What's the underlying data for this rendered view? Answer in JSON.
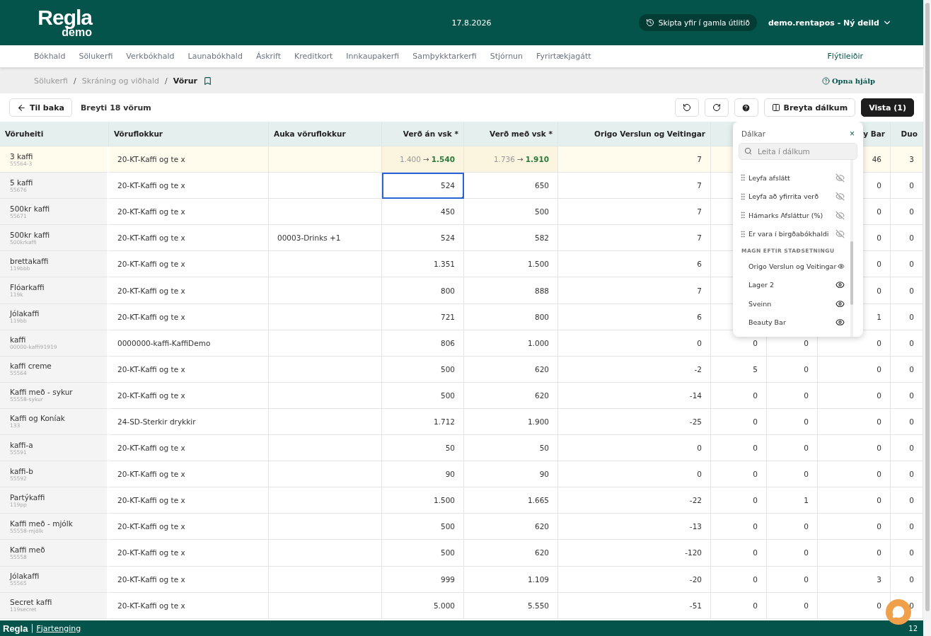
{
  "header": {
    "logo": "Regla",
    "logo_sub": "demo",
    "date": "17.8.2026",
    "switch_button": "Skipta yfir í gamla útlitið",
    "account": "demo.rentapos - Ný deild"
  },
  "nav": {
    "items": [
      {
        "label": "Bókhald"
      },
      {
        "label": "Sölukerfi"
      },
      {
        "label": "Verkbókhald"
      },
      {
        "label": "Launabókhald"
      },
      {
        "label": "Áskrift"
      },
      {
        "label": "Kreditkort"
      },
      {
        "label": "Innkaupakerfi"
      },
      {
        "label": "Samþykktarkerfi"
      },
      {
        "label": "Stjórnun"
      },
      {
        "label": "Fyrirtækjagátt"
      }
    ],
    "shortcuts": "Flýtileiðir"
  },
  "breadcrumbs": {
    "items": [
      "Sölukerfi",
      "Skráning og viðhald",
      "Vörur"
    ],
    "separators": [
      "/",
      "/"
    ],
    "help": "Opna hjálp"
  },
  "toolbar": {
    "back": "Til baka",
    "title": "Breyti 18 vörum",
    "columns_button": "Breyta dálkum",
    "save_button": "Vista (1)"
  },
  "table": {
    "columns": {
      "name": "Vöruheiti",
      "category": "Vöruflokkur",
      "extra": "Auka vöruflokkur",
      "price_ex": "Verð án vsk *",
      "price_inc": "Verð með vsk *",
      "origo": "Origo Verslun og Veitingar",
      "column_9": "y Bar",
      "duo": "Duo"
    },
    "rows": [
      {
        "name": "3 kaffi",
        "sku": "55564-3",
        "category": "20-KT-Kaffi og te x",
        "changed": true,
        "price_ex": {
          "old": "1.400",
          "arrow": "→",
          "value": "1.540",
          "selected": false
        },
        "price_inc": {
          "old": "1.736",
          "arrow": "→",
          "value": "1.910",
          "selected": false
        },
        "qty": {
          "origo": "7",
          "column_9": "46",
          "duo": "3"
        }
      },
      {
        "name": "5 kaffi",
        "sku": "55676",
        "category": "20-KT-Kaffi og te x",
        "changed": false,
        "price_ex": {
          "value": "524",
          "selected": true
        },
        "price_inc": {
          "value": "650",
          "selected": false
        },
        "qty": {
          "origo": "7",
          "column_9": "0",
          "duo": "0"
        }
      },
      {
        "name": "500kr kaffi",
        "sku": "55671",
        "category": "20-KT-Kaffi og te x",
        "changed": false,
        "price_ex": {
          "value": "450",
          "selected": false
        },
        "price_inc": {
          "value": "500",
          "selected": false
        },
        "qty": {
          "origo": "7",
          "column_9": "0",
          "duo": "0"
        }
      },
      {
        "name": "500kr kaffi",
        "sku": "500krkaffi",
        "category": "20-KT-Kaffi og te x",
        "extra": "00003-Drinks +1",
        "changed": false,
        "price_ex": {
          "value": "524",
          "selected": false
        },
        "price_inc": {
          "value": "582",
          "selected": false
        },
        "qty": {
          "origo": "7",
          "column_9": "0",
          "duo": "0"
        }
      },
      {
        "name": "brettakaffi",
        "sku": "119bbb",
        "category": "20-KT-Kaffi og te x",
        "changed": false,
        "price_ex": {
          "value": "1.351",
          "selected": false
        },
        "price_inc": {
          "value": "1.500",
          "selected": false
        },
        "qty": {
          "origo": "6",
          "column_9": "0",
          "duo": "0"
        }
      },
      {
        "name": "Flóarkaffi",
        "sku": "119k",
        "category": "20-KT-Kaffi og te x",
        "changed": false,
        "price_ex": {
          "value": "800",
          "selected": false
        },
        "price_inc": {
          "value": "888",
          "selected": false
        },
        "qty": {
          "origo": "7",
          "column_9": "0",
          "duo": "0"
        }
      },
      {
        "name": "Jólakaffi",
        "sku": "119bb",
        "category": "20-KT-Kaffi og te x",
        "changed": false,
        "price_ex": {
          "value": "721",
          "selected": false
        },
        "price_inc": {
          "value": "800",
          "selected": false
        },
        "qty": {
          "origo": "6",
          "column_9": "1",
          "duo": "0"
        }
      },
      {
        "name": "kaffi",
        "sku": "00000-kaffi91919",
        "category": "0000000-kaffi-KaffiDemo",
        "changed": false,
        "price_ex": {
          "value": "806",
          "selected": false
        },
        "price_inc": {
          "value": "1.000",
          "selected": false
        },
        "qty": {
          "origo": "0",
          "column_7": "0",
          "column_8": "0",
          "column_9": "0",
          "duo": "0"
        }
      },
      {
        "name": "kaffi creme",
        "sku": "55564",
        "category": "20-KT-Kaffi og te x",
        "changed": false,
        "price_ex": {
          "value": "500",
          "selected": false
        },
        "price_inc": {
          "value": "620",
          "selected": false
        },
        "qty": {
          "origo": "-2",
          "column_7": "5",
          "column_8": "0",
          "column_9": "0",
          "duo": "0"
        }
      },
      {
        "name": "Kaffi með - sykur",
        "sku": "55558-sykur",
        "category": "20-KT-Kaffi og te x",
        "changed": false,
        "price_ex": {
          "value": "500",
          "selected": false
        },
        "price_inc": {
          "value": "620",
          "selected": false
        },
        "qty": {
          "origo": "-14",
          "column_7": "0",
          "column_8": "0",
          "column_9": "0",
          "duo": "0"
        }
      },
      {
        "name": "Kaffi og Koníak",
        "sku": "133",
        "category": "24-SD-Sterkir drykkir",
        "changed": false,
        "price_ex": {
          "value": "1.712",
          "selected": false
        },
        "price_inc": {
          "value": "1.900",
          "selected": false
        },
        "qty": {
          "origo": "-25",
          "column_7": "0",
          "column_8": "0",
          "column_9": "0",
          "duo": "0"
        }
      },
      {
        "name": "kaffi-a",
        "sku": "55591",
        "category": "20-KT-Kaffi og te x",
        "changed": false,
        "price_ex": {
          "value": "50",
          "selected": false
        },
        "price_inc": {
          "value": "50",
          "selected": false
        },
        "qty": {
          "origo": "0",
          "column_7": "0",
          "column_8": "0",
          "column_9": "0",
          "duo": "0"
        }
      },
      {
        "name": "kaffi-b",
        "sku": "55592",
        "category": "20-KT-Kaffi og te x",
        "changed": false,
        "price_ex": {
          "value": "90",
          "selected": false
        },
        "price_inc": {
          "value": "90",
          "selected": false
        },
        "qty": {
          "origo": "0",
          "column_7": "0",
          "column_8": "0",
          "column_9": "0",
          "duo": "0"
        }
      },
      {
        "name": "Partýkaffi",
        "sku": "119pp",
        "category": "20-KT-Kaffi og te x",
        "changed": false,
        "price_ex": {
          "value": "1.500",
          "selected": false
        },
        "price_inc": {
          "value": "1.665",
          "selected": false
        },
        "qty": {
          "origo": "-22",
          "column_7": "0",
          "column_8": "1",
          "column_9": "0",
          "duo": "0"
        }
      },
      {
        "name": "Kaffi með - mjólk",
        "sku": "55558-mjólk",
        "category": "20-KT-Kaffi og te x",
        "changed": false,
        "price_ex": {
          "value": "500",
          "selected": false
        },
        "price_inc": {
          "value": "620",
          "selected": false
        },
        "qty": {
          "origo": "-13",
          "column_7": "0",
          "column_8": "0",
          "column_9": "0",
          "duo": "0"
        }
      },
      {
        "name": "Kaffi með",
        "sku": "55558",
        "category": "20-KT-Kaffi og te x",
        "changed": false,
        "price_ex": {
          "value": "500",
          "selected": false
        },
        "price_inc": {
          "value": "620",
          "selected": false
        },
        "qty": {
          "origo": "-120",
          "column_7": "0",
          "column_8": "0",
          "column_9": "0",
          "duo": "0"
        }
      },
      {
        "name": "Jólakaffi",
        "sku": "55565",
        "category": "20-KT-Kaffi og te x",
        "changed": false,
        "price_ex": {
          "value": "999",
          "selected": false
        },
        "price_inc": {
          "value": "1.109",
          "selected": false
        },
        "qty": {
          "origo": "-20",
          "column_7": "0",
          "column_8": "0",
          "column_9": "3",
          "duo": "0"
        }
      },
      {
        "name": "Secret kaffi",
        "sku": "119secret",
        "category": "20-KT-Kaffi og te x",
        "changed": false,
        "price_ex": {
          "value": "5.000",
          "selected": false
        },
        "price_inc": {
          "value": "5.550",
          "selected": false
        },
        "qty": {
          "origo": "-51",
          "column_7": "0",
          "column_8": "0",
          "column_9": "0",
          "duo": "0"
        }
      }
    ]
  },
  "columns_panel": {
    "title": "Dálkar",
    "close": "×",
    "search_placeholder": "Leita í dálkum",
    "items": [
      {
        "kind": "column",
        "label": "Leyfa afslátt",
        "visible": false
      },
      {
        "kind": "column",
        "label": "Leyfa að yfirrita verð",
        "visible": false
      },
      {
        "kind": "column",
        "label": "Hámarks Afsláttur (%)",
        "visible": false
      },
      {
        "kind": "column",
        "label": "Er vara í birgðabókhaldi",
        "visible": false
      },
      {
        "kind": "section",
        "label": "MAGN EFTIR STAÐSETNINGU"
      },
      {
        "kind": "location",
        "label": "Origo Verslun og Veitingar",
        "visible": true
      },
      {
        "kind": "location",
        "label": "Lager 2",
        "visible": true
      },
      {
        "kind": "location",
        "label": "Sveinn",
        "visible": true
      },
      {
        "kind": "location",
        "label": "Beauty Bar",
        "visible": true
      }
    ]
  },
  "footer": {
    "logo": "Regla",
    "separator": "|",
    "link": "Fjartenging",
    "count": "12"
  }
}
